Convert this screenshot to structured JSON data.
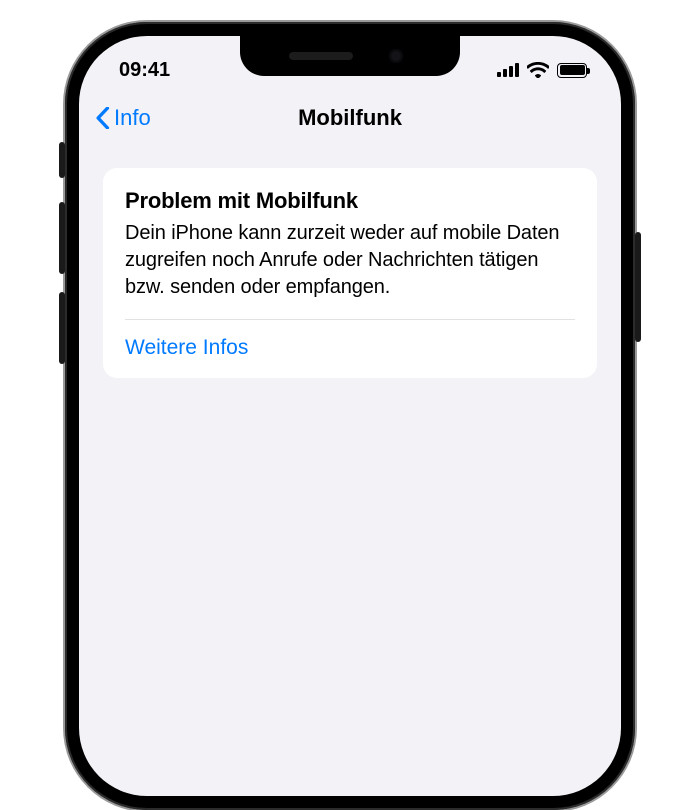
{
  "status_bar": {
    "time": "09:41"
  },
  "nav": {
    "back_label": "Info",
    "title": "Mobilfunk"
  },
  "card": {
    "title": "Problem mit Mobilfunk",
    "body": "Dein iPhone kann zurzeit weder auf mobile Daten zugreifen noch Anrufe oder Nachrichten tätigen bzw. senden oder empfangen.",
    "link_label": "Weitere Infos"
  },
  "colors": {
    "accent": "#007aff",
    "screen_bg": "#f2f2f7"
  }
}
